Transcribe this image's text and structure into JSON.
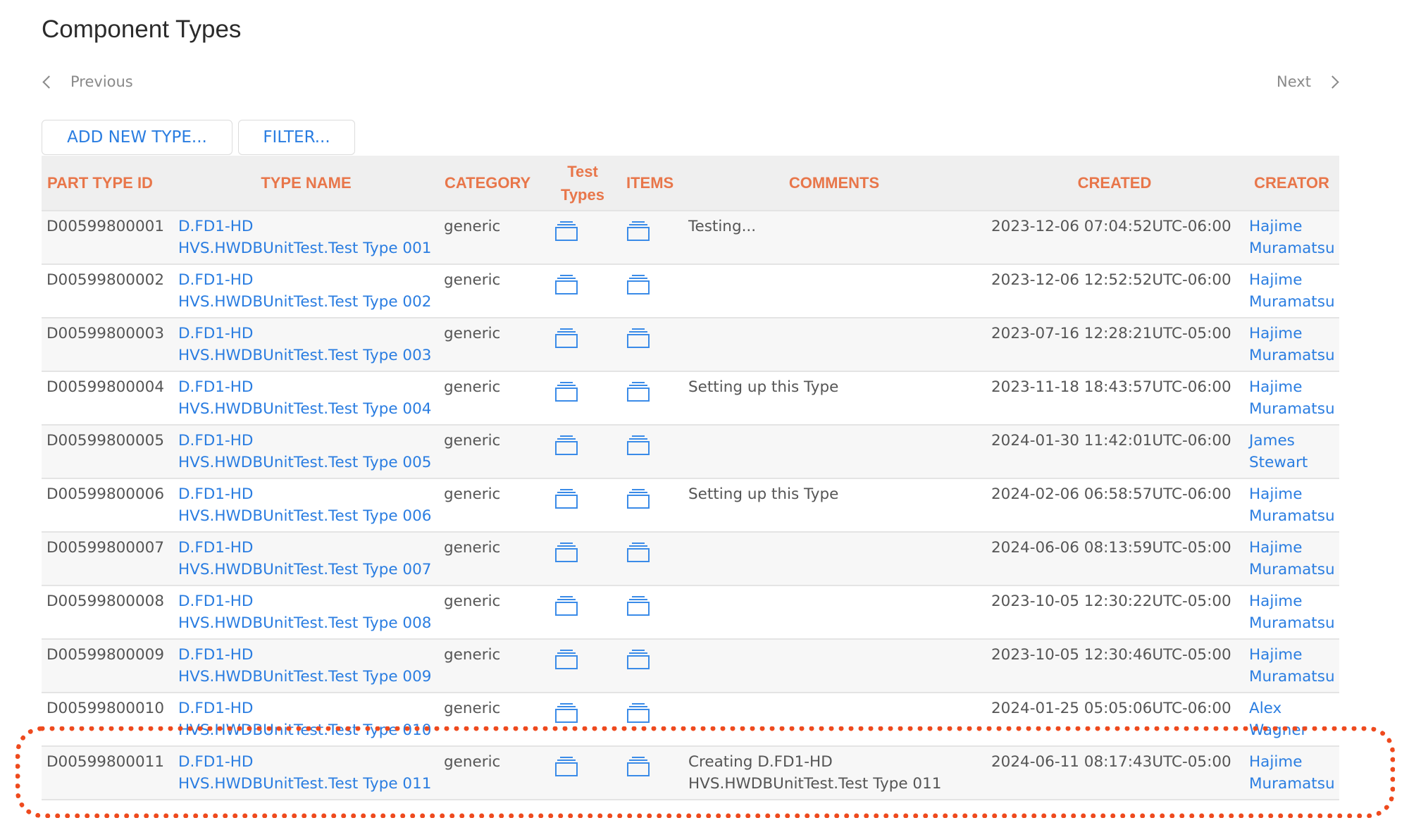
{
  "page": {
    "title": "Component Types"
  },
  "pagination": {
    "previous_label": "Previous",
    "next_label": "Next"
  },
  "toolbar": {
    "add_label": "ADD NEW TYPE...",
    "filter_label": "FILTER..."
  },
  "colors": {
    "header_text": "#e8764a",
    "link": "#2a7de1",
    "highlight": "#ee4a1e"
  },
  "table": {
    "columns": [
      "PART TYPE ID",
      "TYPE NAME",
      "CATEGORY",
      "Test Types",
      "ITEMS",
      "COMMENTS",
      "CREATED",
      "CREATOR"
    ],
    "column_test_types_line1": "Test",
    "column_test_types_line2": "Types",
    "rows": [
      {
        "id": "D00599800001",
        "name_line1": "D.FD1-HD",
        "name_line2": "HVS.HWDBUnitTest.Test Type 001",
        "category": "generic",
        "comment": "Testing...",
        "comment_line2": "",
        "created": "2023-12-06 07:04:52UTC-06:00",
        "creator_first": "Hajime",
        "creator_last": "Muramatsu"
      },
      {
        "id": "D00599800002",
        "name_line1": "D.FD1-HD",
        "name_line2": "HVS.HWDBUnitTest.Test Type 002",
        "category": "generic",
        "comment": "",
        "comment_line2": "",
        "created": "2023-12-06 12:52:52UTC-06:00",
        "creator_first": "Hajime",
        "creator_last": "Muramatsu"
      },
      {
        "id": "D00599800003",
        "name_line1": "D.FD1-HD",
        "name_line2": "HVS.HWDBUnitTest.Test Type 003",
        "category": "generic",
        "comment": "",
        "comment_line2": "",
        "created": "2023-07-16 12:28:21UTC-05:00",
        "creator_first": "Hajime",
        "creator_last": "Muramatsu"
      },
      {
        "id": "D00599800004",
        "name_line1": "D.FD1-HD",
        "name_line2": "HVS.HWDBUnitTest.Test Type 004",
        "category": "generic",
        "comment": "Setting up this Type",
        "comment_line2": "",
        "created": "2023-11-18 18:43:57UTC-06:00",
        "creator_first": "Hajime",
        "creator_last": "Muramatsu"
      },
      {
        "id": "D00599800005",
        "name_line1": "D.FD1-HD",
        "name_line2": "HVS.HWDBUnitTest.Test Type 005",
        "category": "generic",
        "comment": "",
        "comment_line2": "",
        "created": "2024-01-30 11:42:01UTC-06:00",
        "creator_first": "James",
        "creator_last": "Stewart"
      },
      {
        "id": "D00599800006",
        "name_line1": "D.FD1-HD",
        "name_line2": "HVS.HWDBUnitTest.Test Type 006",
        "category": "generic",
        "comment": "Setting up this Type",
        "comment_line2": "",
        "created": "2024-02-06 06:58:57UTC-06:00",
        "creator_first": "Hajime",
        "creator_last": "Muramatsu"
      },
      {
        "id": "D00599800007",
        "name_line1": "D.FD1-HD",
        "name_line2": "HVS.HWDBUnitTest.Test Type 007",
        "category": "generic",
        "comment": "",
        "comment_line2": "",
        "created": "2024-06-06 08:13:59UTC-05:00",
        "creator_first": "Hajime",
        "creator_last": "Muramatsu"
      },
      {
        "id": "D00599800008",
        "name_line1": "D.FD1-HD",
        "name_line2": "HVS.HWDBUnitTest.Test Type 008",
        "category": "generic",
        "comment": "",
        "comment_line2": "",
        "created": "2023-10-05 12:30:22UTC-05:00",
        "creator_first": "Hajime",
        "creator_last": "Muramatsu"
      },
      {
        "id": "D00599800009",
        "name_line1": "D.FD1-HD",
        "name_line2": "HVS.HWDBUnitTest.Test Type 009",
        "category": "generic",
        "comment": "",
        "comment_line2": "",
        "created": "2023-10-05 12:30:46UTC-05:00",
        "creator_first": "Hajime",
        "creator_last": "Muramatsu"
      },
      {
        "id": "D00599800010",
        "name_line1": "D.FD1-HD",
        "name_line2": "HVS.HWDBUnitTest.Test Type 010",
        "category": "generic",
        "comment": "",
        "comment_line2": "",
        "created": "2024-01-25 05:05:06UTC-06:00",
        "creator_first": "Alex",
        "creator_last": "Wagner"
      },
      {
        "id": "D00599800011",
        "name_line1": "D.FD1-HD",
        "name_line2": "HVS.HWDBUnitTest.Test Type 011",
        "category": "generic",
        "comment": "Creating D.FD1-HD",
        "comment_line2": "HVS.HWDBUnitTest.Test Type 011",
        "created": "2024-06-11 08:17:43UTC-05:00",
        "creator_first": "Hajime",
        "creator_last": "Muramatsu"
      }
    ]
  },
  "icons": {
    "test_types": "stack-icon",
    "items": "stack-icon"
  },
  "annotation": {
    "highlighted_row": 11
  }
}
